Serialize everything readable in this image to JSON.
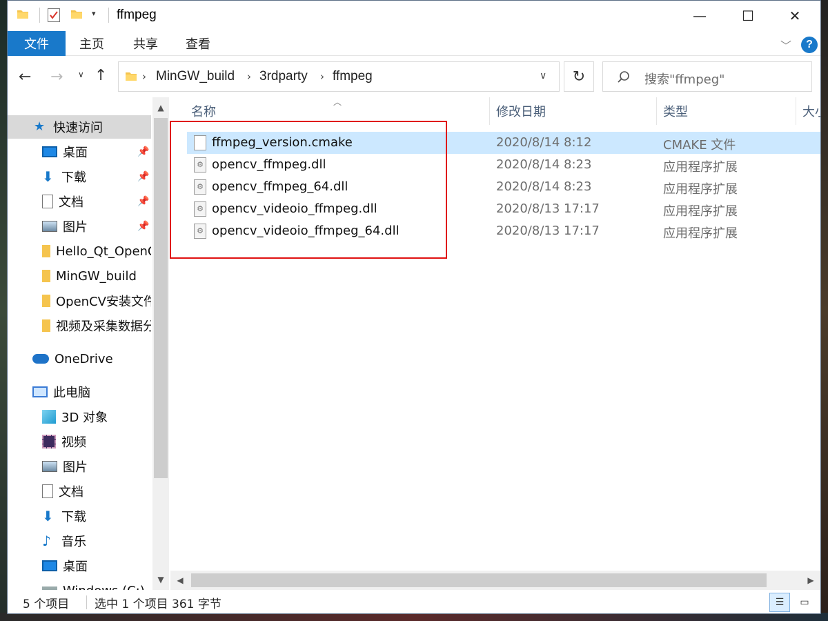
{
  "window": {
    "title": "ffmpeg"
  },
  "ribbon": {
    "tabs": [
      "文件",
      "主页",
      "共享",
      "查看"
    ]
  },
  "address": {
    "crumbs": [
      "MinGW_build",
      "3rdparty",
      "ffmpeg"
    ]
  },
  "search": {
    "placeholder": "搜索\"ffmpeg\""
  },
  "sidebar": {
    "quick_access": "快速访问",
    "items": [
      {
        "label": "桌面",
        "icon": "desktop-icon",
        "pinned": true
      },
      {
        "label": "下载",
        "icon": "download-icon",
        "pinned": true
      },
      {
        "label": "文档",
        "icon": "document-icon",
        "pinned": true
      },
      {
        "label": "图片",
        "icon": "picture-icon",
        "pinned": true
      },
      {
        "label": "Hello_Qt_OpenCV",
        "icon": "folder-icon",
        "pinned": false
      },
      {
        "label": "MinGW_build",
        "icon": "folder-icon",
        "pinned": false
      },
      {
        "label": "OpenCV安装文件",
        "icon": "folder-icon",
        "pinned": false
      },
      {
        "label": "视频及采集数据分析",
        "icon": "folder-icon",
        "pinned": false
      }
    ],
    "onedrive": "OneDrive",
    "this_pc": "此电脑",
    "pc_items": [
      {
        "label": "3D 对象",
        "icon": "cube-icon"
      },
      {
        "label": "视频",
        "icon": "video-icon"
      },
      {
        "label": "图片",
        "icon": "picture-icon"
      },
      {
        "label": "文档",
        "icon": "document-icon"
      },
      {
        "label": "下载",
        "icon": "download-icon"
      },
      {
        "label": "音乐",
        "icon": "music-icon"
      },
      {
        "label": "桌面",
        "icon": "desktop-icon"
      },
      {
        "label": "Windows (C:)",
        "icon": "drive-icon"
      }
    ]
  },
  "columns": {
    "name": "名称",
    "date": "修改日期",
    "type": "类型",
    "size": "大小"
  },
  "files": [
    {
      "name": "ffmpeg_version.cmake",
      "date": "2020/8/14 8:12",
      "type": "CMAKE 文件",
      "selected": true
    },
    {
      "name": "opencv_ffmpeg.dll",
      "date": "2020/8/14 8:23",
      "type": "应用程序扩展",
      "selected": false
    },
    {
      "name": "opencv_ffmpeg_64.dll",
      "date": "2020/8/14 8:23",
      "type": "应用程序扩展",
      "selected": false
    },
    {
      "name": "opencv_videoio_ffmpeg.dll",
      "date": "2020/8/13 17:17",
      "type": "应用程序扩展",
      "selected": false
    },
    {
      "name": "opencv_videoio_ffmpeg_64.dll",
      "date": "2020/8/13 17:17",
      "type": "应用程序扩展",
      "selected": false
    }
  ],
  "status": {
    "count": "5 个项目",
    "selection": "选中 1 个项目  361 字节"
  },
  "colors": {
    "accent": "#1979ca",
    "selection": "#cce8ff",
    "highlight_box": "#e01010"
  }
}
